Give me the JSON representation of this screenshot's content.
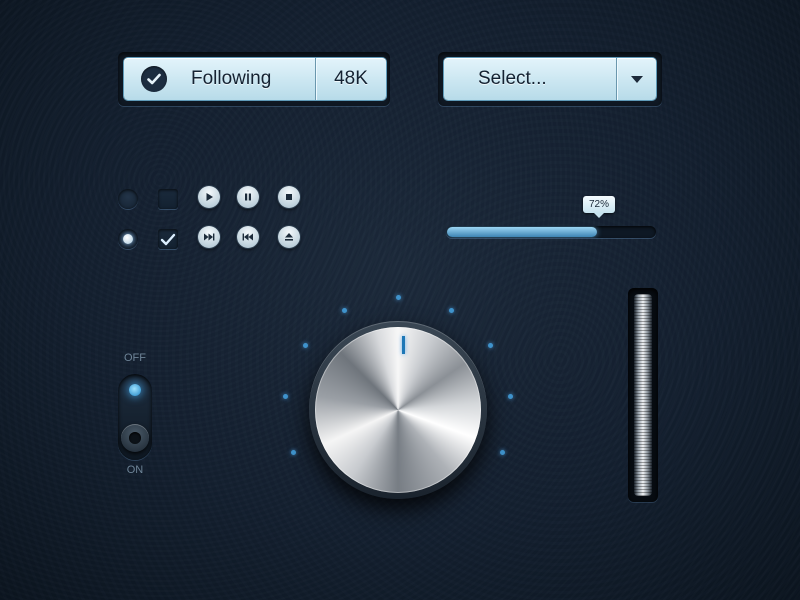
{
  "follow": {
    "label": "Following",
    "count": "48K"
  },
  "select": {
    "label": "Select..."
  },
  "controls": {
    "radio_off": false,
    "radio_on": true,
    "checkbox_unchecked": false,
    "checkbox_checked": true,
    "media_buttons": [
      "play-icon",
      "pause-icon",
      "stop-icon",
      "fast-forward-icon",
      "rewind-icon",
      "eject-icon"
    ]
  },
  "progress": {
    "label": "72%",
    "value": 0.72
  },
  "toggle": {
    "off_label": "OFF",
    "on_label": "ON"
  },
  "knob": {
    "value": 0.5
  },
  "colors": {
    "accent": "#3f93cc",
    "button_top": "#e3f4fb",
    "button_bottom": "#b7dbe9",
    "background": "#142030"
  }
}
